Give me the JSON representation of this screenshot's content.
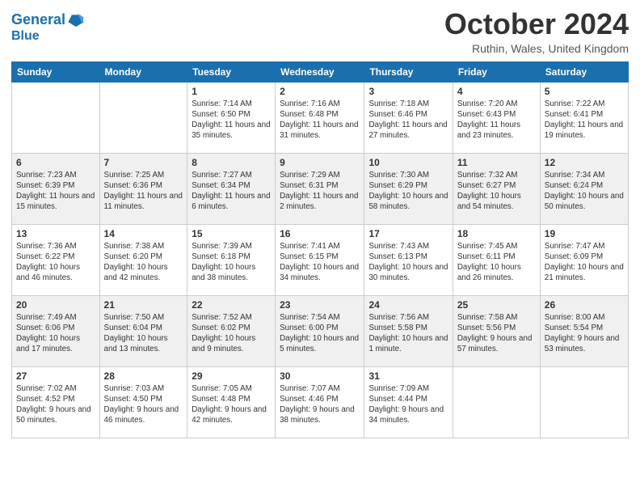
{
  "header": {
    "logo_line1": "General",
    "logo_line2": "Blue",
    "title": "October 2024",
    "location": "Ruthin, Wales, United Kingdom"
  },
  "days_of_week": [
    "Sunday",
    "Monday",
    "Tuesday",
    "Wednesday",
    "Thursday",
    "Friday",
    "Saturday"
  ],
  "weeks": [
    [
      {
        "day": "",
        "info": ""
      },
      {
        "day": "",
        "info": ""
      },
      {
        "day": "1",
        "info": "Sunrise: 7:14 AM\nSunset: 6:50 PM\nDaylight: 11 hours and 35 minutes."
      },
      {
        "day": "2",
        "info": "Sunrise: 7:16 AM\nSunset: 6:48 PM\nDaylight: 11 hours and 31 minutes."
      },
      {
        "day": "3",
        "info": "Sunrise: 7:18 AM\nSunset: 6:46 PM\nDaylight: 11 hours and 27 minutes."
      },
      {
        "day": "4",
        "info": "Sunrise: 7:20 AM\nSunset: 6:43 PM\nDaylight: 11 hours and 23 minutes."
      },
      {
        "day": "5",
        "info": "Sunrise: 7:22 AM\nSunset: 6:41 PM\nDaylight: 11 hours and 19 minutes."
      }
    ],
    [
      {
        "day": "6",
        "info": "Sunrise: 7:23 AM\nSunset: 6:39 PM\nDaylight: 11 hours and 15 minutes."
      },
      {
        "day": "7",
        "info": "Sunrise: 7:25 AM\nSunset: 6:36 PM\nDaylight: 11 hours and 11 minutes."
      },
      {
        "day": "8",
        "info": "Sunrise: 7:27 AM\nSunset: 6:34 PM\nDaylight: 11 hours and 6 minutes."
      },
      {
        "day": "9",
        "info": "Sunrise: 7:29 AM\nSunset: 6:31 PM\nDaylight: 11 hours and 2 minutes."
      },
      {
        "day": "10",
        "info": "Sunrise: 7:30 AM\nSunset: 6:29 PM\nDaylight: 10 hours and 58 minutes."
      },
      {
        "day": "11",
        "info": "Sunrise: 7:32 AM\nSunset: 6:27 PM\nDaylight: 10 hours and 54 minutes."
      },
      {
        "day": "12",
        "info": "Sunrise: 7:34 AM\nSunset: 6:24 PM\nDaylight: 10 hours and 50 minutes."
      }
    ],
    [
      {
        "day": "13",
        "info": "Sunrise: 7:36 AM\nSunset: 6:22 PM\nDaylight: 10 hours and 46 minutes."
      },
      {
        "day": "14",
        "info": "Sunrise: 7:38 AM\nSunset: 6:20 PM\nDaylight: 10 hours and 42 minutes."
      },
      {
        "day": "15",
        "info": "Sunrise: 7:39 AM\nSunset: 6:18 PM\nDaylight: 10 hours and 38 minutes."
      },
      {
        "day": "16",
        "info": "Sunrise: 7:41 AM\nSunset: 6:15 PM\nDaylight: 10 hours and 34 minutes."
      },
      {
        "day": "17",
        "info": "Sunrise: 7:43 AM\nSunset: 6:13 PM\nDaylight: 10 hours and 30 minutes."
      },
      {
        "day": "18",
        "info": "Sunrise: 7:45 AM\nSunset: 6:11 PM\nDaylight: 10 hours and 26 minutes."
      },
      {
        "day": "19",
        "info": "Sunrise: 7:47 AM\nSunset: 6:09 PM\nDaylight: 10 hours and 21 minutes."
      }
    ],
    [
      {
        "day": "20",
        "info": "Sunrise: 7:49 AM\nSunset: 6:06 PM\nDaylight: 10 hours and 17 minutes."
      },
      {
        "day": "21",
        "info": "Sunrise: 7:50 AM\nSunset: 6:04 PM\nDaylight: 10 hours and 13 minutes."
      },
      {
        "day": "22",
        "info": "Sunrise: 7:52 AM\nSunset: 6:02 PM\nDaylight: 10 hours and 9 minutes."
      },
      {
        "day": "23",
        "info": "Sunrise: 7:54 AM\nSunset: 6:00 PM\nDaylight: 10 hours and 5 minutes."
      },
      {
        "day": "24",
        "info": "Sunrise: 7:56 AM\nSunset: 5:58 PM\nDaylight: 10 hours and 1 minute."
      },
      {
        "day": "25",
        "info": "Sunrise: 7:58 AM\nSunset: 5:56 PM\nDaylight: 9 hours and 57 minutes."
      },
      {
        "day": "26",
        "info": "Sunrise: 8:00 AM\nSunset: 5:54 PM\nDaylight: 9 hours and 53 minutes."
      }
    ],
    [
      {
        "day": "27",
        "info": "Sunrise: 7:02 AM\nSunset: 4:52 PM\nDaylight: 9 hours and 50 minutes."
      },
      {
        "day": "28",
        "info": "Sunrise: 7:03 AM\nSunset: 4:50 PM\nDaylight: 9 hours and 46 minutes."
      },
      {
        "day": "29",
        "info": "Sunrise: 7:05 AM\nSunset: 4:48 PM\nDaylight: 9 hours and 42 minutes."
      },
      {
        "day": "30",
        "info": "Sunrise: 7:07 AM\nSunset: 4:46 PM\nDaylight: 9 hours and 38 minutes."
      },
      {
        "day": "31",
        "info": "Sunrise: 7:09 AM\nSunset: 4:44 PM\nDaylight: 9 hours and 34 minutes."
      },
      {
        "day": "",
        "info": ""
      },
      {
        "day": "",
        "info": ""
      }
    ]
  ]
}
